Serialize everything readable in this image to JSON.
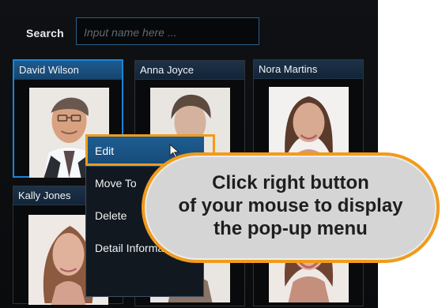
{
  "search": {
    "label": "Search",
    "placeholder": "Input name here ..."
  },
  "face_cards": [
    {
      "name": "David Wilson",
      "selected": true,
      "portrait_icon": "male-portrait-icon"
    },
    {
      "name": "Anna Joyce",
      "selected": false,
      "portrait_icon": "female-portrait-icon"
    },
    {
      "name": "Nora Martins",
      "selected": false,
      "portrait_icon": "female-portrait-icon"
    },
    {
      "name": "Kally Jones",
      "selected": false,
      "portrait_icon": "female-portrait-icon"
    }
  ],
  "context_menu": {
    "items": [
      {
        "label": "Edit",
        "active": true
      },
      {
        "label": "Move To",
        "active": false
      },
      {
        "label": "Delete",
        "active": false
      },
      {
        "label": "Detail Information",
        "active": false
      }
    ]
  },
  "callout": {
    "line1": "Click right button",
    "line2": "of your mouse to display",
    "line3": "the pop-up menu"
  },
  "colors": {
    "accent_orange": "#f19b1b",
    "accent_blue": "#1a84d8",
    "screen_background": "#0f1114",
    "callout_background": "#d5d5d5"
  },
  "icons": {
    "cursor": "mouse-cursor-icon"
  }
}
